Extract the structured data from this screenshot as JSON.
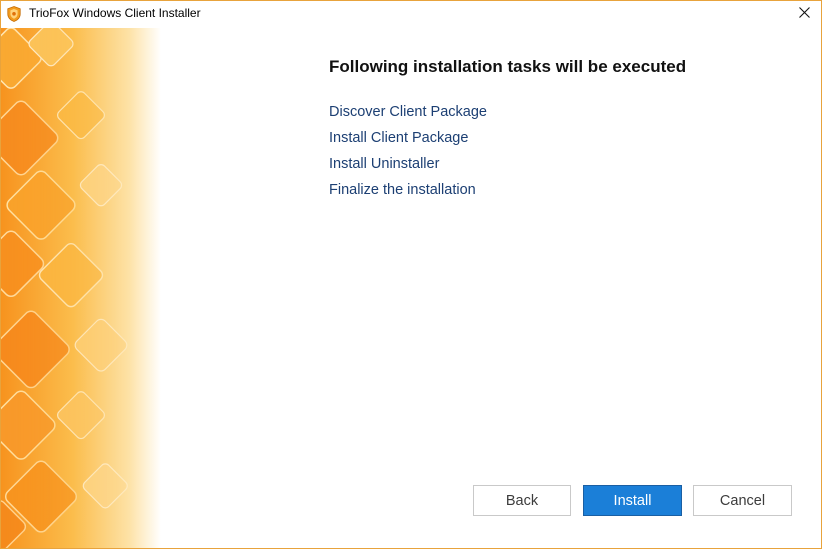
{
  "window": {
    "title": "TrioFox Windows Client Installer"
  },
  "main": {
    "heading": "Following installation tasks will be executed",
    "tasks": [
      "Discover Client Package",
      "Install Client Package",
      "Install Uninstaller",
      "Finalize the installation"
    ]
  },
  "buttons": {
    "back_label": "Back",
    "install_label": "Install",
    "cancel_label": "Cancel"
  },
  "colors": {
    "accent": "#1b7fd8",
    "task_text": "#1c3f73",
    "brand_orange": "#f5a623"
  },
  "icons": {
    "app": "shield-icon",
    "close": "close-icon"
  }
}
